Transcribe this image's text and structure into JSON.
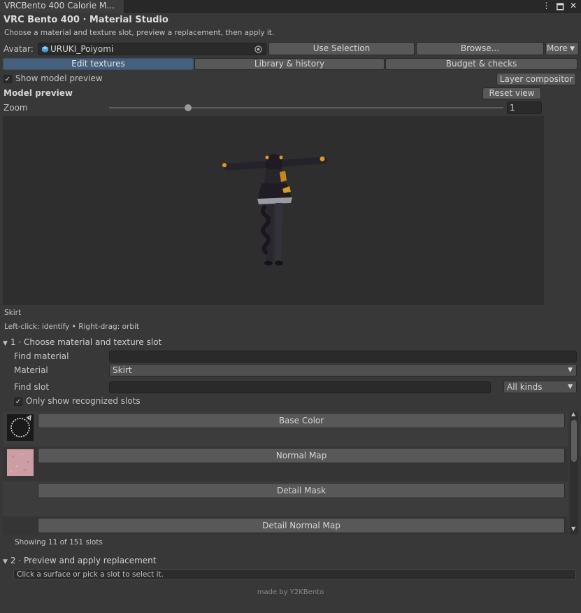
{
  "window": {
    "tab_title": "VRCBento 400 Calorie M...",
    "menu_icon": "⋮",
    "maximize_icon": "🗖",
    "close_icon": "✕"
  },
  "header": {
    "title": "VRC Bento 400 · Material Studio",
    "subtitle": "Choose a material and texture slot, preview a replacement, then apply it."
  },
  "avatar": {
    "label": "Avatar:",
    "value": "URUKI_Poiyomi",
    "use_selection": "Use Selection",
    "browse": "Browse...",
    "more": "More"
  },
  "tabs": [
    {
      "label": "Edit textures",
      "selected": true
    },
    {
      "label": "Library & history",
      "selected": false
    },
    {
      "label": "Budget & checks",
      "selected": false
    }
  ],
  "preview": {
    "show_model_preview": "Show model preview",
    "layer_compositor": "Layer compositor",
    "heading": "Model preview",
    "reset_view": "Reset view",
    "zoom_label": "Zoom",
    "zoom_value": "1",
    "zoom_fraction": 0.2,
    "hover_name": "Skirt",
    "controls_hint": "Left-click: identify  •  Right-drag: orbit"
  },
  "section1": {
    "title": "1 · Choose material and texture slot",
    "find_material_label": "Find material",
    "find_material_value": "",
    "material_label": "Material",
    "material_value": "Skirt",
    "find_slot_label": "Find slot",
    "find_slot_value": "",
    "kinds_value": "All kinds",
    "only_recognized": "Only show recognized slots",
    "slots": [
      {
        "label": "Base Color",
        "thumb": "ring-texture"
      },
      {
        "label": "Normal Map",
        "thumb": "pink-texture"
      },
      {
        "label": "Detail Mask",
        "thumb": "none"
      },
      {
        "label": "Detail Normal Map",
        "thumb": "none"
      }
    ],
    "count_text": "Showing 11 of 151 slots"
  },
  "section2": {
    "title": "2 · Preview and apply replacement",
    "hint": "Click a surface or pick a slot to select it."
  },
  "footer": "made by Y2KBento",
  "colors": {
    "accent": "#46607c",
    "background": "#383838"
  }
}
